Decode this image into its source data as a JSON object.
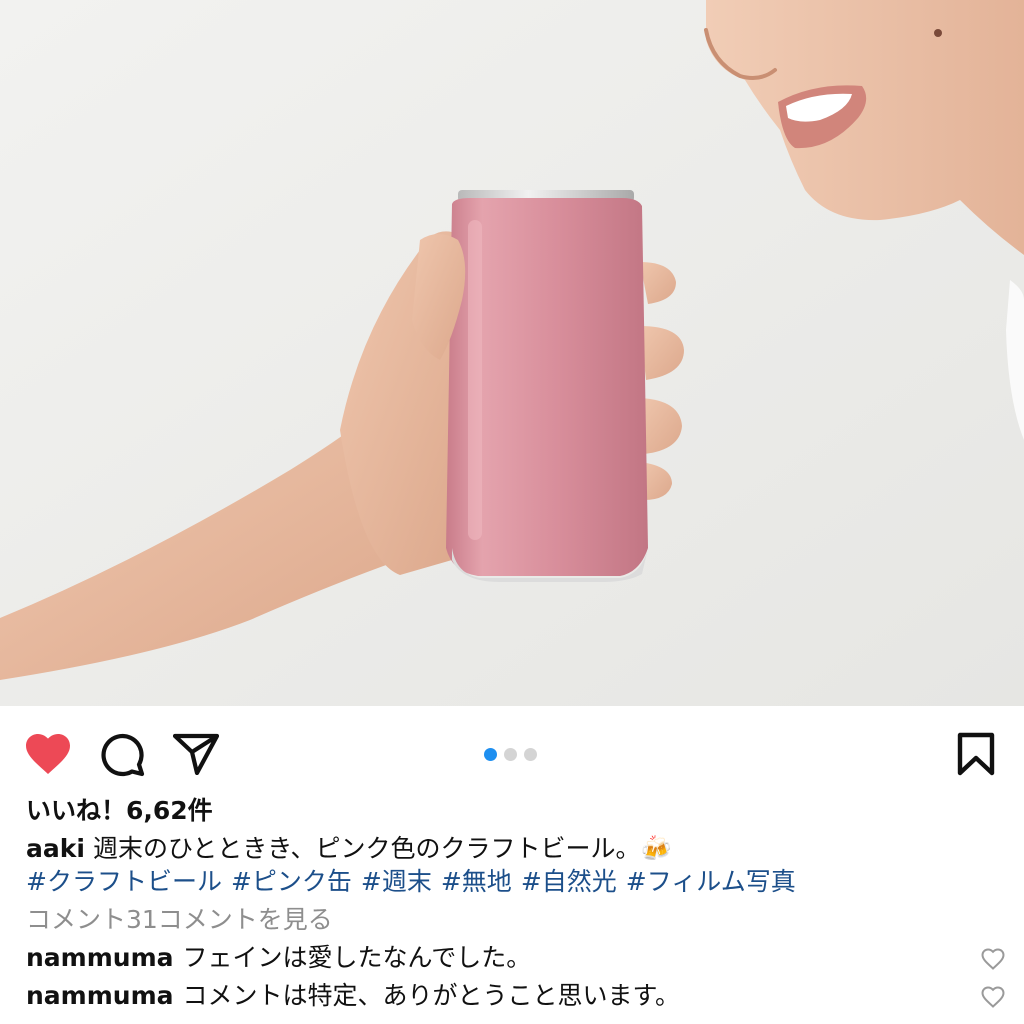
{
  "post": {
    "image": {
      "description_icon": "photo",
      "carousel": {
        "total": 3,
        "active_index": 0
      }
    },
    "actions": {
      "like_icon": "heart-filled-icon",
      "comment_icon": "comment-bubble-icon",
      "share_icon": "paper-plane-icon",
      "save_icon": "bookmark-icon",
      "liked_color": "#ed4956"
    },
    "likes_text": "いいね！6,62件",
    "caption": {
      "username": "aaki",
      "text": "週末のひとときき、ピンク色のクラフトビール。🍻",
      "hashtags": [
        "#クラフトビール",
        "#ピンク缶",
        "#週末",
        "#無地",
        "#自然光",
        "#フィルム写真"
      ]
    },
    "view_comments_text": "コメント31コメントを見る",
    "comments": [
      {
        "username": "nammuma",
        "text": "フェインは愛したなんでした。"
      },
      {
        "username": "nammuma",
        "text": "コメントは特定、ありがとうこと思います。"
      }
    ],
    "colors": {
      "hashtag": "#1c4f8a",
      "muted": "#8e8e8e",
      "dot_active": "#1e8ff0",
      "dot_inactive": "#d4d4d4",
      "can_pink": "#d98d9a"
    }
  }
}
